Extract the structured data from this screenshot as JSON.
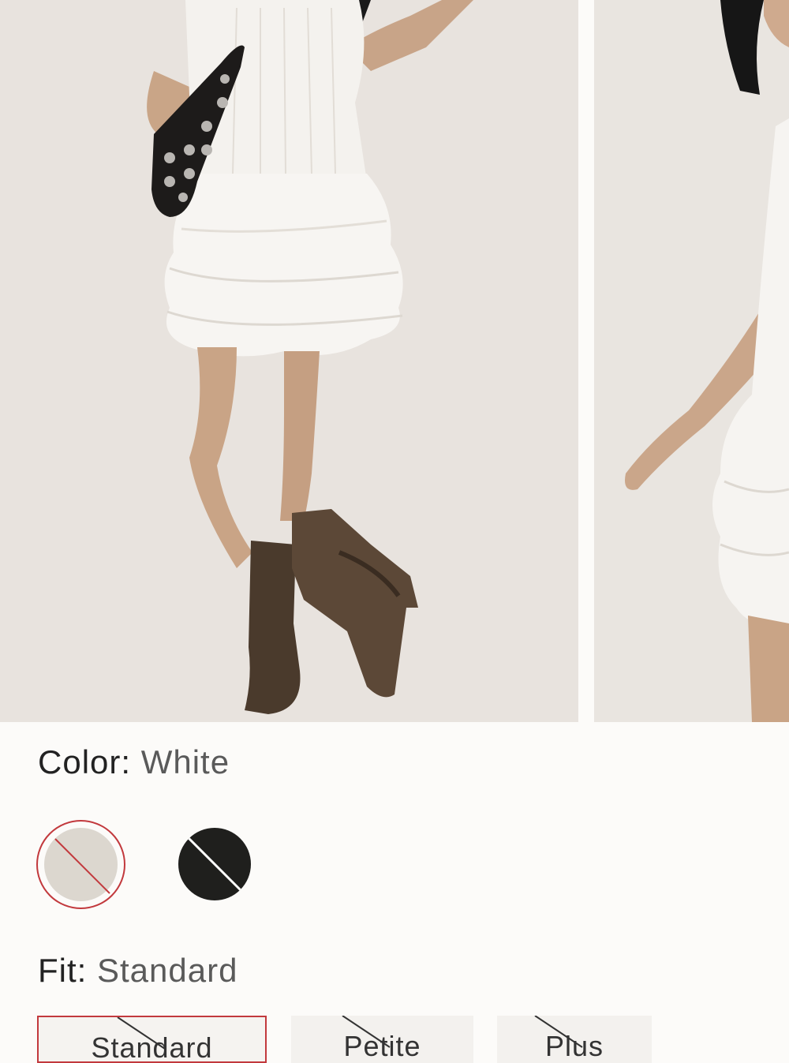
{
  "gallery": {
    "images": [
      {
        "alt": "model-front-view"
      },
      {
        "alt": "model-side-view"
      }
    ]
  },
  "color": {
    "label": "Color:",
    "selected": "White",
    "swatches": [
      {
        "name": "White",
        "hex": "#dcd7cf",
        "unavailable": true,
        "selected": true
      },
      {
        "name": "Black",
        "hex": "#1f1f1d",
        "unavailable": true,
        "selected": false
      }
    ]
  },
  "fit": {
    "label": "Fit:",
    "selected": "Standard",
    "options": [
      {
        "label": "Standard",
        "unavailable": true,
        "selected": true
      },
      {
        "label": "Petite",
        "unavailable": true,
        "selected": false
      },
      {
        "label": "Plus",
        "unavailable": true,
        "selected": false
      }
    ]
  },
  "colors": {
    "accent": "#c2393d",
    "background": "#fcfbf9"
  }
}
